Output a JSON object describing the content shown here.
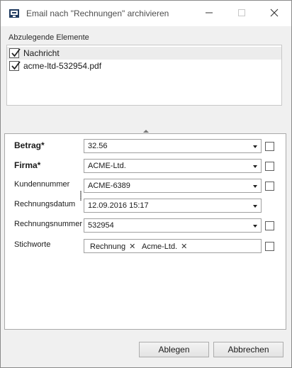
{
  "window": {
    "title": "Email nach \"Rechnungen\" archivieren"
  },
  "elements_section": {
    "label": "Abzulegende Elemente",
    "items": [
      {
        "label": "Nachricht",
        "checked": true,
        "selected": true
      },
      {
        "label": "acme-ltd-532954.pdf",
        "checked": true,
        "selected": false
      }
    ]
  },
  "form": {
    "fields": [
      {
        "label": "Betrag*",
        "value": "32.56"
      },
      {
        "label": "Firma*",
        "value": "ACME-Ltd."
      },
      {
        "label": "Kundennummer",
        "value": "ACME-6389"
      },
      {
        "label": "Rechnungsdatum",
        "value": "12.09.2016 15:17"
      },
      {
        "label": "Rechnungsnummer",
        "value": "532954"
      }
    ],
    "tags_field": {
      "label": "Stichworte",
      "tags": [
        "Rechnung",
        "Acme-Ltd."
      ]
    }
  },
  "buttons": {
    "ok_label": "Ablegen",
    "cancel_label": "Abbrechen"
  }
}
